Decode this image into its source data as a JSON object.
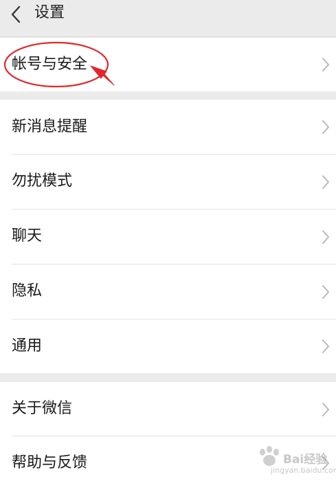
{
  "header": {
    "title": "设置",
    "back_icon": "chevron-left-icon"
  },
  "groups": [
    {
      "items": [
        {
          "label": "帐号与安全"
        }
      ]
    },
    {
      "items": [
        {
          "label": "新消息提醒"
        },
        {
          "label": "勿扰模式"
        },
        {
          "label": "聊天"
        },
        {
          "label": "隐私"
        },
        {
          "label": "通用"
        }
      ]
    },
    {
      "items": [
        {
          "label": "关于微信"
        },
        {
          "label": "帮助与反馈"
        }
      ]
    }
  ],
  "annotation": {
    "color": "#e0272b",
    "shape": "ellipse-with-arrow"
  },
  "watermark": {
    "text": "Bai经验",
    "sub": "jingyan.baidu.com"
  },
  "colors": {
    "background": "#ebebeb",
    "row_bg": "#ffffff",
    "chevron": "#b8b8b8",
    "annotation": "#e0272b"
  }
}
